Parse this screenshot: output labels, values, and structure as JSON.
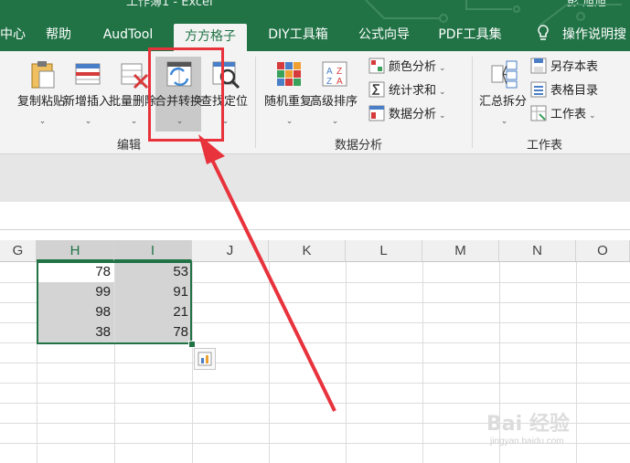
{
  "window": {
    "title_fragment": "工作簿1 - Excel",
    "account_fragment": "彭 旭旭"
  },
  "tabs": [
    {
      "label": "中心"
    },
    {
      "label": "帮助"
    },
    {
      "label": "AudTool"
    },
    {
      "label": "方方格子",
      "active": true
    },
    {
      "label": "DIY工具箱"
    },
    {
      "label": "公式向导"
    },
    {
      "label": "PDF工具集"
    },
    {
      "label": "操作说明搜"
    }
  ],
  "ribbon": {
    "groups": {
      "edit": "编辑",
      "data_analysis": "数据分析",
      "worksheet": "工作表"
    },
    "buttons": {
      "copy_paste": "复制粘贴",
      "insert": "新增插入",
      "batch_delete": "批量删除",
      "merge_convert": "合并转换",
      "find_locate": "查找定位",
      "random_repeat": "随机重复",
      "advanced_sort": "高级排序",
      "color_analysis": "颜色分析",
      "stat_sum": "统计求和",
      "data_analysis": "数据分析",
      "summarize_split": "汇总拆分",
      "save_sheet_as": "另存本表",
      "sheet_toc": "表格目录",
      "worksheet": "工作表"
    }
  },
  "grid": {
    "columns": [
      "G",
      "H",
      "I",
      "J",
      "K",
      "L",
      "M",
      "N",
      "O"
    ],
    "selected_columns": [
      "H",
      "I"
    ],
    "rows": [
      [
        "78",
        "53"
      ],
      [
        "99",
        "91"
      ],
      [
        "98",
        "21"
      ],
      [
        "38",
        "78"
      ]
    ]
  },
  "watermark": {
    "brand": "Bai 经验",
    "url": "jingyan.baidu.com"
  },
  "colors": {
    "excel_green": "#217346",
    "annotation_red": "#e8323c",
    "selection_shade": "#d4d4d4"
  }
}
